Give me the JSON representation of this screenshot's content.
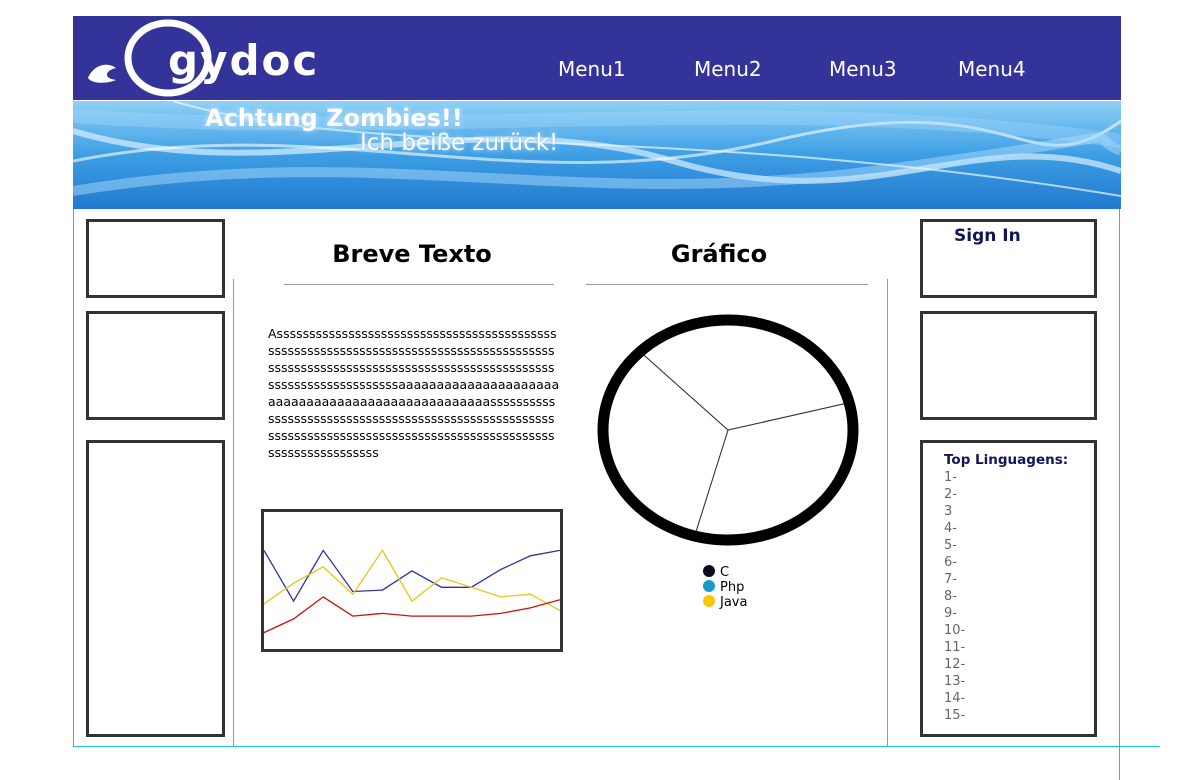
{
  "header": {
    "logo_text": "gydoc",
    "menu": [
      "Menu1",
      "Menu2",
      "Menu3",
      "Menu4"
    ]
  },
  "banner": {
    "title": "Achtung Zombies!!",
    "subtitle": "Ich beiße zurück!"
  },
  "content": {
    "text_section": {
      "title": "Breve Texto",
      "body": "Asssssssssssssssssssssssssssssssssssssssssssssssssssssssssssssssssssssssssssssssssssssssssssssssssssssssssssssssssssssssssssssssssssssssssssssssssssssssaaaaaaaaaaaaaaaaaaaaaaaaaaaaaaaaaaaaaaaaaaaaaaaaaasssssssssssssssssssssssssssssssssssssssssssssssssssssssssssssssssssssssssssssssssssssssssssssssssssssssssssssssssss"
    },
    "chart_section": {
      "title": "Gráfico"
    }
  },
  "chart_data": [
    {
      "type": "line",
      "title": "",
      "series": [
        {
          "color": "#333399",
          "values": [
            0.72,
            0.35,
            0.72,
            0.42,
            0.43,
            0.57,
            0.45,
            0.45,
            0.58,
            0.68,
            0.72
          ]
        },
        {
          "color": "#e6c619",
          "values": [
            0.33,
            0.48,
            0.6,
            0.4,
            0.72,
            0.35,
            0.52,
            0.45,
            0.38,
            0.4,
            0.28
          ]
        },
        {
          "color": "#cc1111",
          "values": [
            0.12,
            0.22,
            0.38,
            0.24,
            0.26,
            0.24,
            0.24,
            0.24,
            0.26,
            0.3,
            0.36
          ]
        }
      ]
    },
    {
      "type": "pie",
      "title": "",
      "labels": [
        "C",
        "Php",
        "Java"
      ],
      "colors": [
        "#0b0b1e",
        "#1a99cc",
        "#f5c800"
      ],
      "values": [
        33.3,
        33.3,
        33.4
      ]
    }
  ],
  "sidebar_right": {
    "signin_label": "Sign In",
    "top_title": "Top Linguagens:",
    "top_items": [
      "1-",
      "2-",
      "3",
      "4-",
      "5-",
      "6-",
      "7-",
      "8-",
      "9-",
      "10-",
      "11-",
      "12-",
      "13-",
      "14-",
      "15-"
    ]
  }
}
